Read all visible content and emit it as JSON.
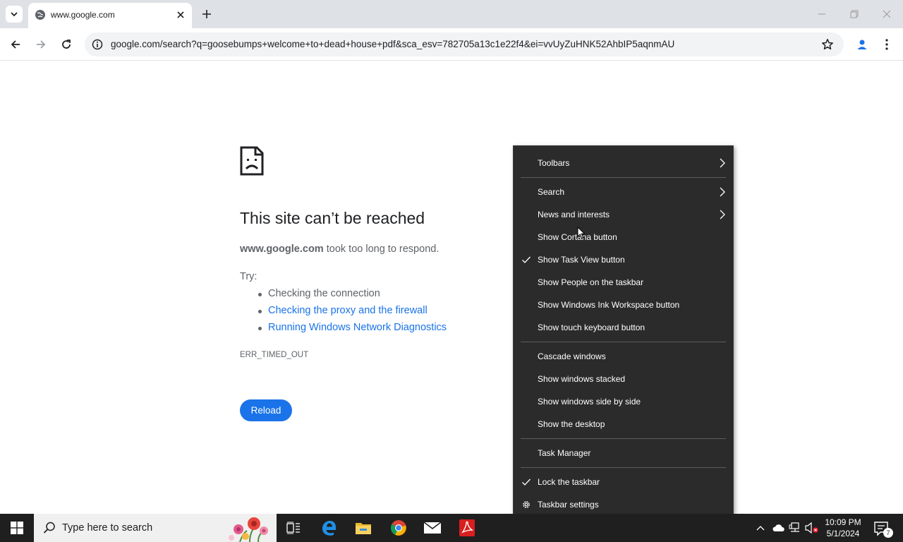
{
  "browser": {
    "tab": {
      "title": "www.google.com"
    },
    "url": "google.com/search?q=goosebumps+welcome+to+dead+house+pdf&sca_esv=782705a13c1e22f4&ei=vvUyZuHNK52AhbIP5aqnmAU"
  },
  "error_page": {
    "title": "This site can’t be reached",
    "host": "www.google.com",
    "message": " took too long to respond.",
    "try_label": "Try:",
    "suggestions": [
      "Checking the connection",
      "Checking the proxy and the firewall",
      "Running Windows Network Diagnostics"
    ],
    "error_code": "ERR_TIMED_OUT",
    "reload_label": "Reload"
  },
  "context_menu": {
    "items": [
      {
        "label": "Toolbars",
        "submenu": true
      },
      {
        "label": "Search",
        "submenu": true
      },
      {
        "label": "News and interests",
        "submenu": true
      },
      {
        "label": "Show Cortana button"
      },
      {
        "label": "Show Task View button",
        "checked": true
      },
      {
        "label": "Show People on the taskbar"
      },
      {
        "label": "Show Windows Ink Workspace button"
      },
      {
        "label": "Show touch keyboard button"
      },
      {
        "label": "Cascade windows"
      },
      {
        "label": "Show windows stacked"
      },
      {
        "label": "Show windows side by side"
      },
      {
        "label": "Show the desktop"
      },
      {
        "label": "Task Manager"
      },
      {
        "label": "Lock the taskbar",
        "checked": true
      },
      {
        "label": "Taskbar settings",
        "icon": "gear-icon"
      }
    ]
  },
  "taskbar": {
    "search_placeholder": "Type here to search",
    "pinned": [
      "task-view-icon",
      "edge-icon",
      "file-explorer-icon",
      "chrome-icon",
      "mail-icon",
      "acrobat-icon"
    ],
    "clock_time": "10:09 PM",
    "clock_date": "5/1/2024",
    "notification_count": "7"
  },
  "colors": {
    "link": "#1a73e8",
    "menu_bg": "#2b2b2b",
    "taskbar_bg": "#1f1f1f",
    "tabstrip_bg": "#dee1e6"
  }
}
